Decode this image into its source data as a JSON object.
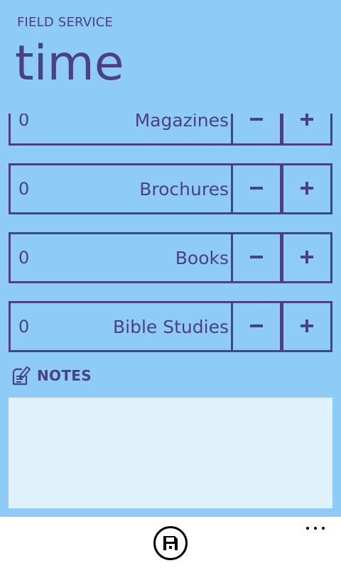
{
  "app": {
    "title": "FIELD SERVICE",
    "page_title": "time"
  },
  "counters": [
    {
      "label": "Magazines",
      "value": "0",
      "decrement": "−",
      "increment": "+"
    },
    {
      "label": "Brochures",
      "value": "0",
      "decrement": "−",
      "increment": "+"
    },
    {
      "label": "Books",
      "value": "0",
      "decrement": "−",
      "increment": "+"
    },
    {
      "label": "Bible Studies",
      "value": "0",
      "decrement": "−",
      "increment": "+"
    }
  ],
  "notes": {
    "label": "NOTES",
    "icon": "notes-edit-icon",
    "value": ""
  },
  "app_bar": {
    "save_icon": "save-icon",
    "more_icon": "more-options-icon"
  },
  "colors": {
    "background": "#8ecbf7",
    "accent": "#4b3f86",
    "notes_background": "#e0f1fb",
    "app_bar_background": "#ffffff"
  }
}
